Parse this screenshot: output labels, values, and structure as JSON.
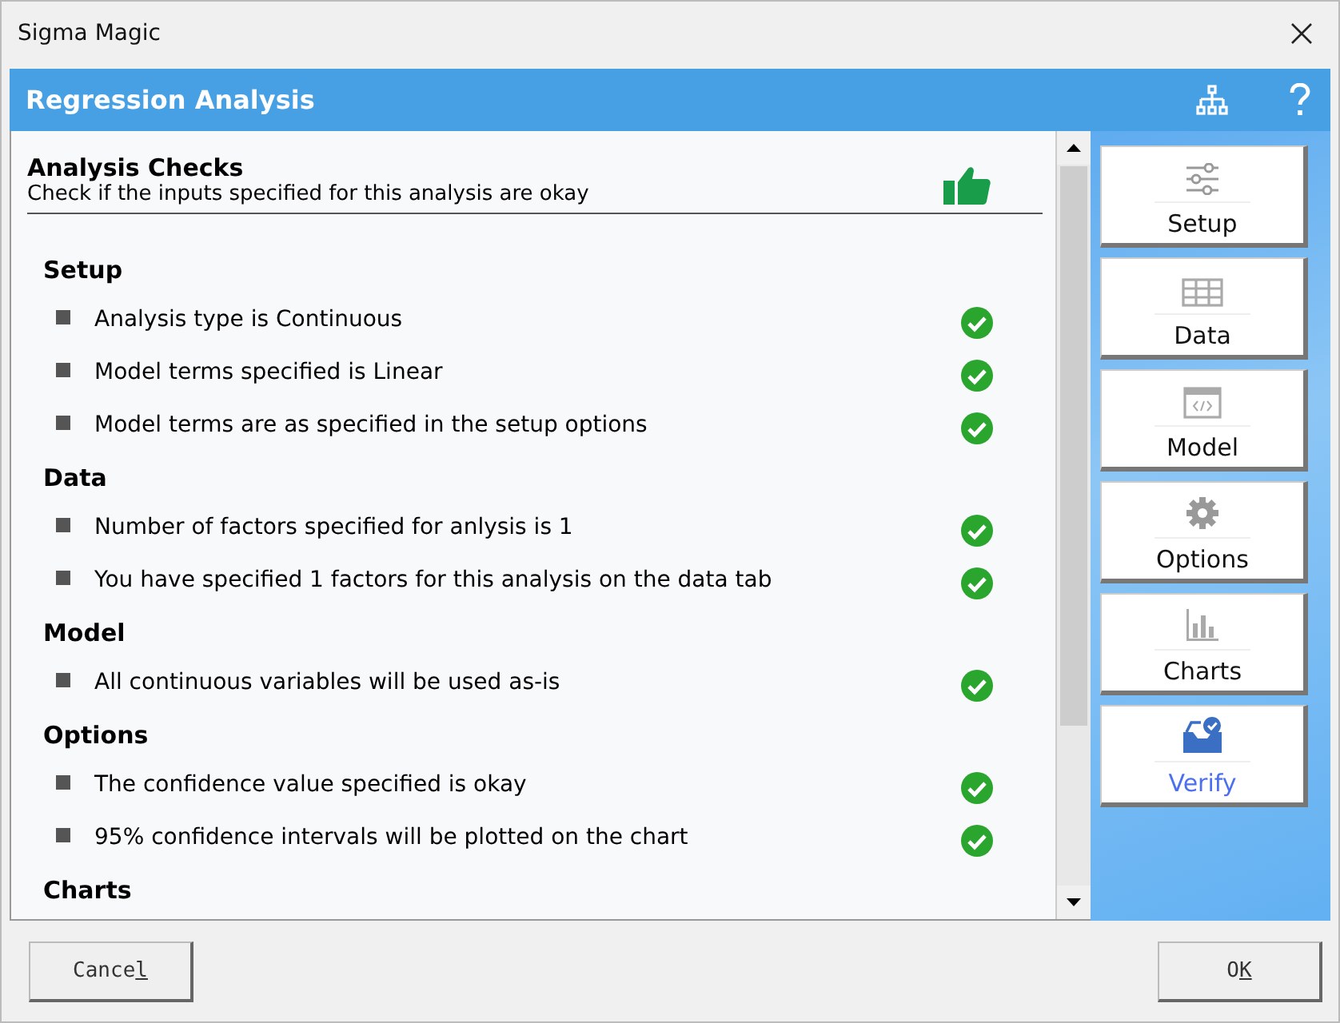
{
  "window": {
    "title": "Sigma Magic"
  },
  "header": {
    "title": "Regression Analysis"
  },
  "checks": {
    "title": "Analysis Checks",
    "subtitle": "Check if the inputs specified for this analysis are okay",
    "sections": [
      {
        "title": "Setup",
        "items": [
          {
            "text": "Analysis type is Continuous",
            "ok": true
          },
          {
            "text": "Model terms specified is Linear",
            "ok": true
          },
          {
            "text": "Model terms are as specified in the setup options",
            "ok": true
          }
        ]
      },
      {
        "title": "Data",
        "items": [
          {
            "text": "Number of factors specified for anlysis is 1",
            "ok": true
          },
          {
            "text": "You have specified 1 factors for this analysis on the data tab",
            "ok": true
          }
        ]
      },
      {
        "title": "Model",
        "items": [
          {
            "text": "All continuous variables will be used as-is",
            "ok": true
          }
        ]
      },
      {
        "title": "Options",
        "items": [
          {
            "text": "The confidence value specified is okay",
            "ok": true
          },
          {
            "text": "95% confidence intervals will be plotted on the chart",
            "ok": true
          }
        ]
      },
      {
        "title": "Charts"
      }
    ]
  },
  "nav": [
    {
      "kind": "setup",
      "label": "Setup",
      "selected": false
    },
    {
      "kind": "data",
      "label": "Data",
      "selected": false
    },
    {
      "kind": "model",
      "label": "Model",
      "selected": false
    },
    {
      "kind": "options",
      "label": "Options",
      "selected": false
    },
    {
      "kind": "charts",
      "label": "Charts",
      "selected": false
    },
    {
      "kind": "verify",
      "label": "Verify",
      "selected": true
    }
  ],
  "footer": {
    "cancel": {
      "before": "Cance",
      "mnemonic": "l"
    },
    "ok": {
      "before": "O",
      "mnemonic": "K"
    }
  }
}
